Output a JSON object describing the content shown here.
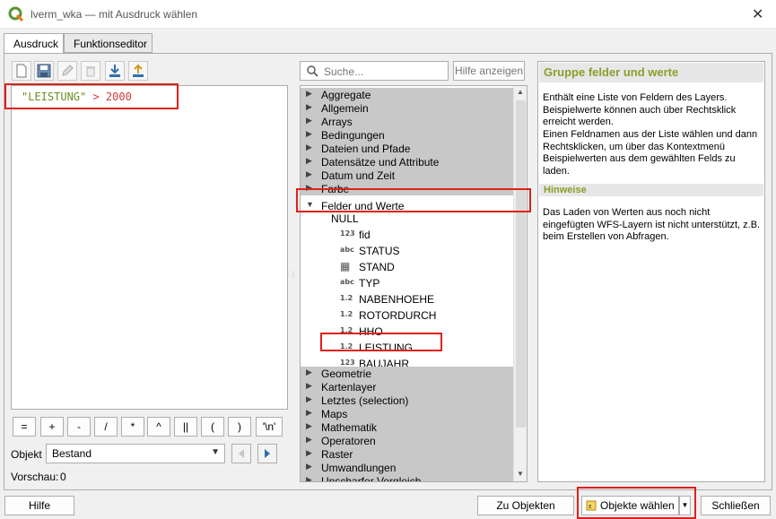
{
  "window": {
    "title": "lverm_wka — mit Ausdruck wählen",
    "close_glyph": "✕"
  },
  "tabs": [
    {
      "label": "Ausdruck"
    },
    {
      "label": "Funktionseditor"
    }
  ],
  "editor": {
    "field_token": "\"LEISTUNG\"",
    "operator_token": "> 2000"
  },
  "operator_buttons": [
    "=",
    "+",
    "-",
    "/",
    "*",
    "^",
    "||",
    "(",
    ")",
    "'\\n'"
  ],
  "feature": {
    "label": "Objekt",
    "value": "Bestand",
    "preview_label": "Vorschau:",
    "preview_value": "0"
  },
  "search": {
    "placeholder": "Suche...",
    "help_button": "Hilfe anzeigen"
  },
  "tree": {
    "groups_before": [
      "Aggregate",
      "Allgemein",
      "Arrays",
      "Bedingungen",
      "Dateien und Pfade",
      "Datensätze und Attribute",
      "Datum und Zeit",
      "Farbe"
    ],
    "expanded_group": "Felder und Werte",
    "fields": [
      {
        "type": "",
        "name": "NULL"
      },
      {
        "type": "123",
        "name": "fid"
      },
      {
        "type": "abc",
        "name": "STATUS"
      },
      {
        "type": "calendar",
        "name": "STAND"
      },
      {
        "type": "abc",
        "name": "TYP"
      },
      {
        "type": "1.2",
        "name": "NABENHOEHE"
      },
      {
        "type": "1.2",
        "name": "ROTORDURCH"
      },
      {
        "type": "1.2",
        "name": "HHO"
      },
      {
        "type": "1.2",
        "name": "LEISTUNG"
      },
      {
        "type": "123",
        "name": "BAUJAHR"
      }
    ],
    "groups_after": [
      "Geometrie",
      "Kartenlayer",
      "Letztes (selection)",
      "Maps",
      "Mathematik",
      "Operatoren",
      "Raster",
      "Umwandlungen",
      "Unscharfer Vergleich"
    ]
  },
  "help_panel": {
    "title": "Gruppe felder und werte",
    "para1": "Enthält eine Liste von Feldern des Layers. Beispielwerte können auch über Rechtsklick erreicht werden.",
    "para2": "Einen Feldnamen aus der Liste wählen und dann Rechtsklicken, um über das Kontextmenü Beispielwerten aus dem gewählten Felds zu laden.",
    "hint_title": "Hinweise",
    "hint_text": "Das Laden von Werten aus noch nicht eingefügten WFS-Layern ist nicht unterstützt, z.B. beim Erstellen von Abfragen."
  },
  "footer": {
    "help": "Hilfe",
    "zoom": "Zu Objekten zoomen",
    "select": "Objekte wählen",
    "close": "Schließen"
  },
  "colors": {
    "highlight_box": "#e0201a",
    "field_token": "#6b8e23",
    "operator_token": "#d23a3a",
    "group_bg": "#c8c8c8",
    "help_heading": "#8a9f2b"
  }
}
